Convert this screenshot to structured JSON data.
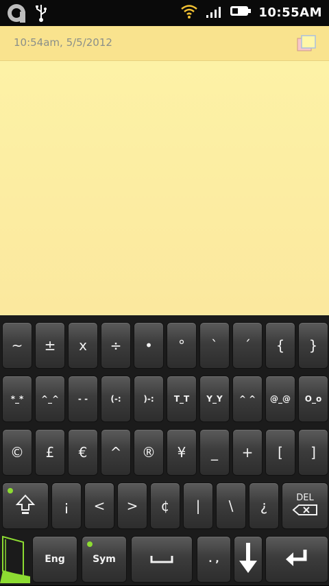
{
  "status_bar": {
    "time": "10:55AM",
    "icons": [
      "aptoide-icon",
      "usb-icon",
      "wifi-icon",
      "signal-icon",
      "battery-icon"
    ]
  },
  "note": {
    "timestamp": "10:54am, 5/5/2012",
    "copy_icon": "copy-notes-icon",
    "background_color": "#fdf0a6"
  },
  "keyboard": {
    "row1": [
      "~",
      "±",
      "x",
      "÷",
      "•",
      "°",
      "`",
      "´",
      "{",
      "}"
    ],
    "row2": [
      "*_*",
      "^_^",
      "- -",
      "(-:",
      ")-:",
      "T_T",
      "Y_Y",
      "^ ^",
      "@_@",
      "O_o"
    ],
    "row3": [
      "©",
      "£",
      "€",
      "^",
      "®",
      "¥",
      "_",
      "+",
      "[",
      "]"
    ],
    "row4": [
      "¡",
      "<",
      ">",
      "¢",
      "|",
      "\\",
      "¿"
    ],
    "shift_icon": "shift-up-arrow-icon",
    "del_label": "DEL",
    "eng_label": "Eng",
    "sym_label": "Sym",
    "space_icon": "space-bar-icon",
    "punct_label": ". ,",
    "hide_icon": "hide-keyboard-arrow-icon",
    "enter_icon": "enter-return-icon",
    "accent_color": "#8ddc32"
  }
}
